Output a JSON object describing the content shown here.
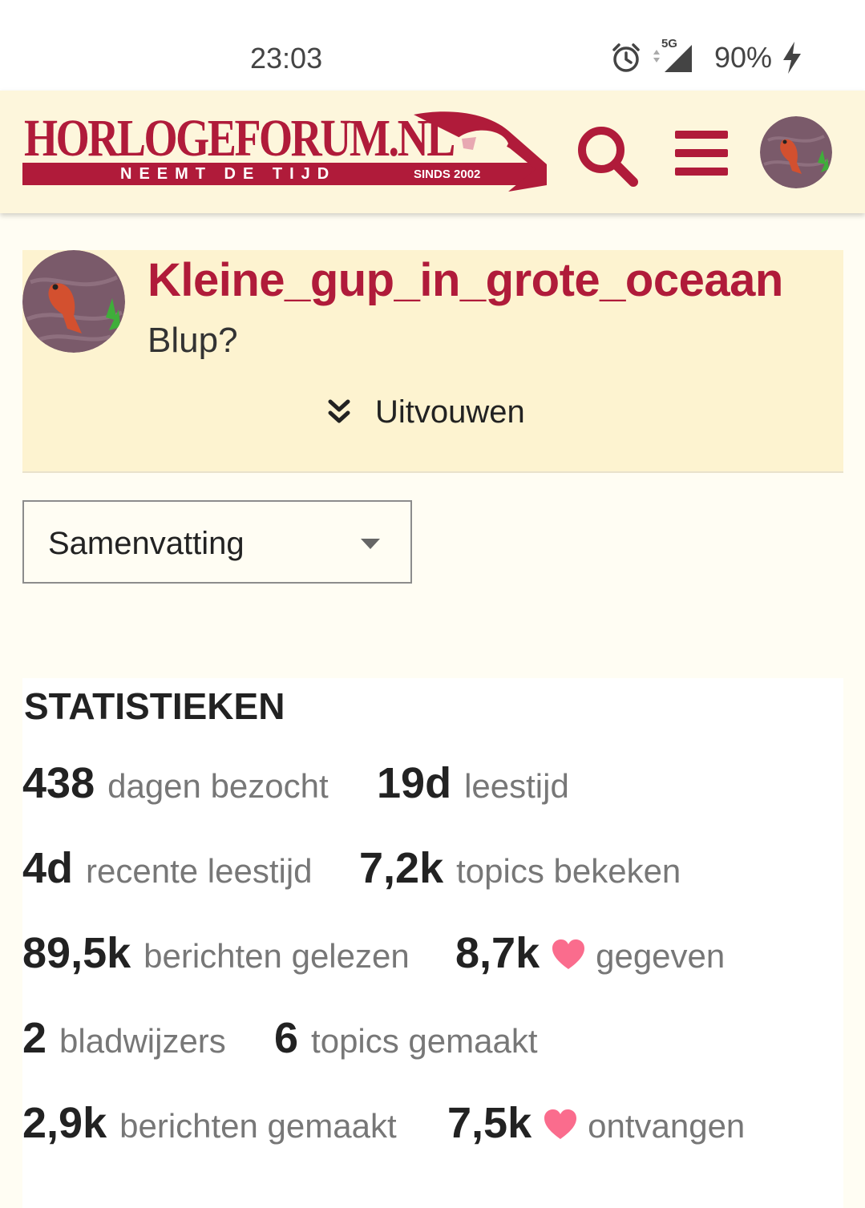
{
  "status_bar": {
    "time": "23:03",
    "network": "5G",
    "battery": "90%"
  },
  "header": {
    "logo_title": "HORLOGEFORUM.NL",
    "logo_slogan": "NEEMT DE TIJD",
    "logo_since": "SINDS 2002",
    "icons": [
      "search-icon",
      "hamburger-menu-icon",
      "user-avatar"
    ]
  },
  "profile": {
    "username": "Kleine_gup_in_grote_oceaan",
    "bio": "Blup?",
    "expand_label": "Uitvouwen"
  },
  "section_select": {
    "selected": "Samenvatting"
  },
  "stats": {
    "title": "STATISTIEKEN",
    "items": [
      {
        "value": "438",
        "label": "dagen bezocht"
      },
      {
        "value": "19d",
        "label": "leestijd"
      },
      {
        "value": "4d",
        "label": "recente leestijd"
      },
      {
        "value": "7,2k",
        "label": "topics bekeken"
      },
      {
        "value": "89,5k",
        "label": "berichten gelezen"
      },
      {
        "value": "8,7k",
        "label": "gegeven",
        "icon": "heart-icon"
      },
      {
        "value": "2",
        "label": "bladwijzers"
      },
      {
        "value": "6",
        "label": "topics gemaakt"
      },
      {
        "value": "2,9k",
        "label": "berichten gemaakt"
      },
      {
        "value": "7,5k",
        "label": "ontvangen",
        "icon": "heart-icon"
      }
    ]
  },
  "colors": {
    "brand": "#b01b3a",
    "header_bg": "#fdf6dc",
    "card_bg": "#fdf3d0",
    "heart": "#fa6c8d"
  }
}
